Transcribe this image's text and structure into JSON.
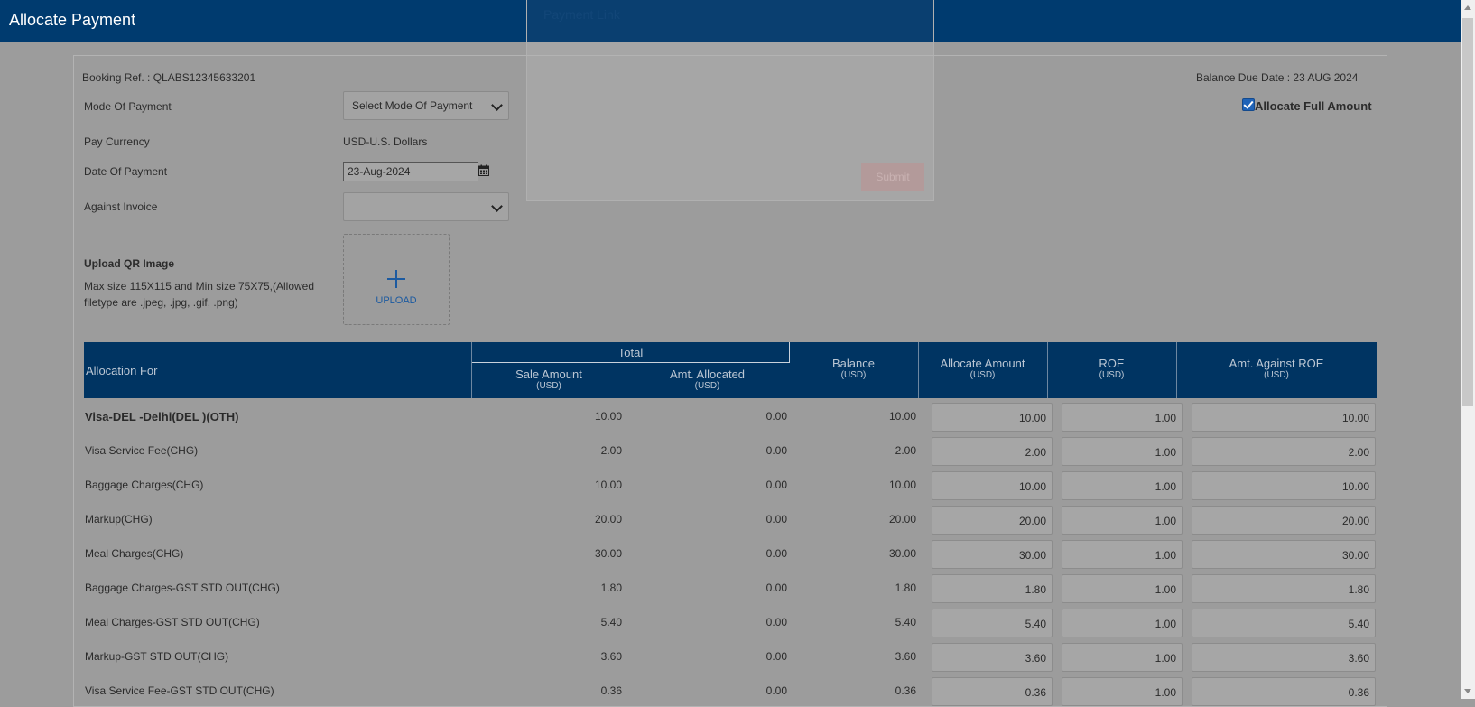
{
  "header": {
    "title": "Allocate Payment"
  },
  "modal": {
    "title": "Payment Link",
    "submit_label": "Submit"
  },
  "form": {
    "booking_ref_label": "Booking Ref. : QLABS12345633201",
    "balance_due_label": "Balance Due Date : 23 AUG 2024",
    "mode_label": "Mode Of Payment",
    "mode_value": "Select Mode Of Payment",
    "currency_label": "Pay Currency",
    "currency_value": "USD-U.S. Dollars",
    "date_label": "Date Of Payment",
    "date_value": "23-Aug-2024",
    "invoice_label": "Against Invoice",
    "invoice_value": "",
    "allocate_full_label": "Allocate Full Amount",
    "allocate_full_checked": true,
    "upload_title": "Upload QR Image",
    "upload_help_1": "Max size 115X115 and Min size 75X75,(Allowed",
    "upload_help_2": "filetype are .jpeg, .jpg, .gif, .png)",
    "upload_label": "UPLOAD"
  },
  "table": {
    "headers": {
      "allocation_for": "Allocation For",
      "total": "Total",
      "sale_amount": "Sale Amount",
      "amt_allocated": "Amt. Allocated",
      "balance": "Balance",
      "allocate_amount": "Allocate Amount",
      "roe": "ROE",
      "amt_against_roe": "Amt. Against ROE",
      "unit": "(USD)"
    },
    "rows": [
      {
        "name": "Visa-DEL -Delhi(DEL )(OTH)",
        "sale": "10.00",
        "allocated": "0.00",
        "balance": "10.00",
        "allocate": "10.00",
        "roe": "1.00",
        "against": "10.00",
        "bold": true
      },
      {
        "name": "Visa Service Fee(CHG)",
        "sale": "2.00",
        "allocated": "0.00",
        "balance": "2.00",
        "allocate": "2.00",
        "roe": "1.00",
        "against": "2.00"
      },
      {
        "name": "Baggage Charges(CHG)",
        "sale": "10.00",
        "allocated": "0.00",
        "balance": "10.00",
        "allocate": "10.00",
        "roe": "1.00",
        "against": "10.00"
      },
      {
        "name": "Markup(CHG)",
        "sale": "20.00",
        "allocated": "0.00",
        "balance": "20.00",
        "allocate": "20.00",
        "roe": "1.00",
        "against": "20.00"
      },
      {
        "name": "Meal Charges(CHG)",
        "sale": "30.00",
        "allocated": "0.00",
        "balance": "30.00",
        "allocate": "30.00",
        "roe": "1.00",
        "against": "30.00"
      },
      {
        "name": "Baggage Charges-GST STD OUT(CHG)",
        "sale": "1.80",
        "allocated": "0.00",
        "balance": "1.80",
        "allocate": "1.80",
        "roe": "1.00",
        "against": "1.80"
      },
      {
        "name": "Meal Charges-GST STD OUT(CHG)",
        "sale": "5.40",
        "allocated": "0.00",
        "balance": "5.40",
        "allocate": "5.40",
        "roe": "1.00",
        "against": "5.40"
      },
      {
        "name": "Markup-GST STD OUT(CHG)",
        "sale": "3.60",
        "allocated": "0.00",
        "balance": "3.60",
        "allocate": "3.60",
        "roe": "1.00",
        "against": "3.60"
      },
      {
        "name": "Visa Service Fee-GST STD OUT(CHG)",
        "sale": "0.36",
        "allocated": "0.00",
        "balance": "0.36",
        "allocate": "0.36",
        "roe": "1.00",
        "against": "0.36"
      }
    ]
  }
}
